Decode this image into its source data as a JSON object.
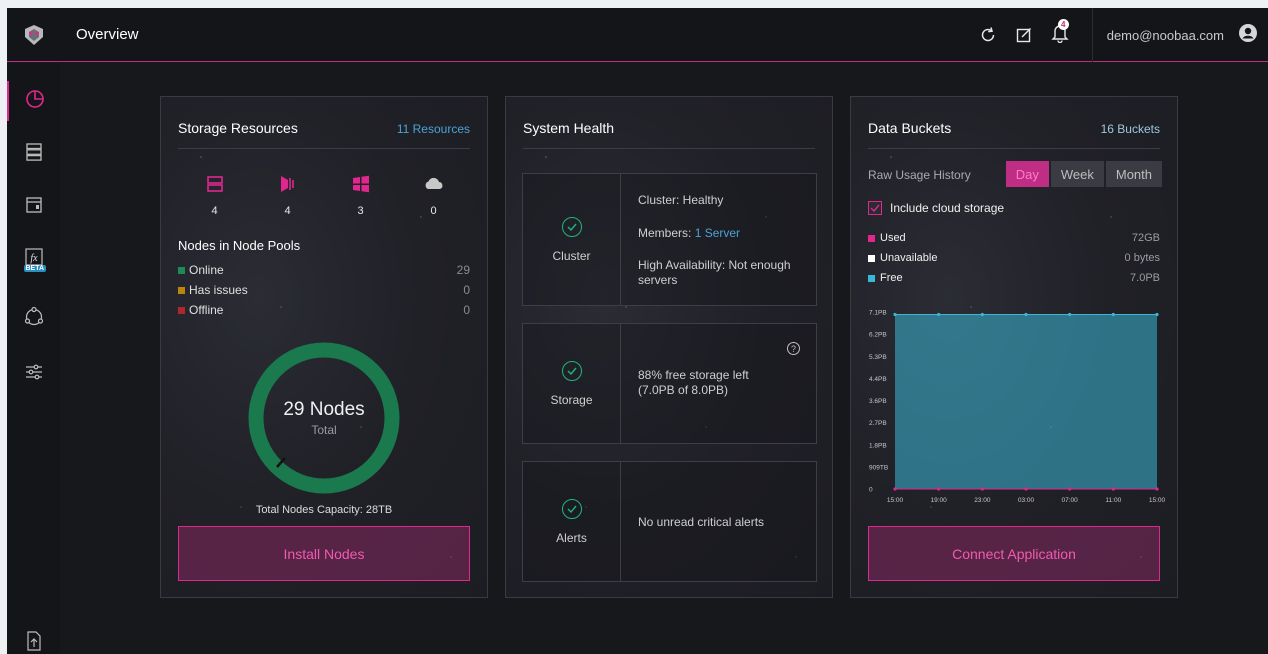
{
  "header": {
    "title": "Overview",
    "notification_count": "4",
    "user_email": "demo@noobaa.com"
  },
  "icons": {
    "logo": "noobaa-logo-icon",
    "refresh": "refresh-icon",
    "edit": "edit-icon",
    "bell": "bell-icon",
    "user": "user-avatar-icon"
  },
  "sidebar": {
    "items": [
      {
        "icon": "overview-pie-icon",
        "active": true
      },
      {
        "icon": "storage-resources-icon"
      },
      {
        "icon": "buckets-icon"
      },
      {
        "icon": "functions-icon",
        "badge": "BETA"
      },
      {
        "icon": "cluster-icon"
      },
      {
        "icon": "settings-sliders-icon"
      },
      {
        "icon": "upload-file-icon"
      }
    ],
    "fx_label": "fx"
  },
  "storage": {
    "title": "Storage Resources",
    "count_link": "11 Resources",
    "resources": [
      {
        "icon": "server-icon",
        "count": "4"
      },
      {
        "icon": "azure-icon",
        "count": "4"
      },
      {
        "icon": "windows-icon",
        "count": "3"
      },
      {
        "icon": "cloud-icon",
        "count": "0"
      }
    ],
    "nodes_title": "Nodes in Node Pools",
    "legend": [
      {
        "label": "Online",
        "value": "29",
        "color": "#1e8a5a"
      },
      {
        "label": "Has issues",
        "value": "0",
        "color": "#b8860b"
      },
      {
        "label": "Offline",
        "value": "0",
        "color": "#b0262f"
      }
    ],
    "donut_main": "29 Nodes",
    "donut_sub": "Total",
    "capacity": "Total Nodes Capacity: 28TB",
    "install_button": "Install Nodes"
  },
  "health": {
    "title": "System Health",
    "cluster": {
      "label": "Cluster",
      "status": "Cluster: Healthy",
      "members_prefix": "Members: ",
      "members_link": "1 Server",
      "ha": "High Availability: Not enough servers"
    },
    "storage": {
      "label": "Storage",
      "line1": "88% free storage left",
      "line2": "(7.0PB of 8.0PB)",
      "help": "?"
    },
    "alerts": {
      "label": "Alerts",
      "text": "No unread critical alerts"
    }
  },
  "buckets": {
    "title": "Data Buckets",
    "count": "16 Buckets",
    "usage_label": "Raw Usage History",
    "periods": [
      "Day",
      "Week",
      "Month"
    ],
    "selected_period": "Day",
    "cloud_label": "Include cloud storage",
    "cloud_checked": true,
    "usage": [
      {
        "label": "Used",
        "value": "72GB",
        "color": "#e0278e"
      },
      {
        "label": "Unavailable",
        "value": "0 bytes",
        "color": "#ffffff"
      },
      {
        "label": "Free",
        "value": "7.0PB",
        "color": "#3ab7d6"
      }
    ],
    "connect_button": "Connect Application"
  },
  "chart_data": {
    "type": "area",
    "x": [
      "15:00",
      "19:00",
      "23:00",
      "03:00",
      "07:00",
      "11:00",
      "15:00"
    ],
    "y_ticks": [
      "0",
      "909TB",
      "1.8PB",
      "2.7PB",
      "3.6PB",
      "4.4PB",
      "5.3PB",
      "6.2PB",
      "7.1PB"
    ],
    "series": [
      {
        "name": "Free",
        "values": [
          7.0,
          7.0,
          7.0,
          7.0,
          7.0,
          7.0,
          7.0
        ],
        "color": "#3ab7d6"
      },
      {
        "name": "Used",
        "values": [
          0,
          0,
          0,
          0,
          0,
          0,
          0
        ],
        "color": "#e0278e"
      }
    ],
    "ylim": [
      0,
      7.1
    ],
    "grid": false
  }
}
